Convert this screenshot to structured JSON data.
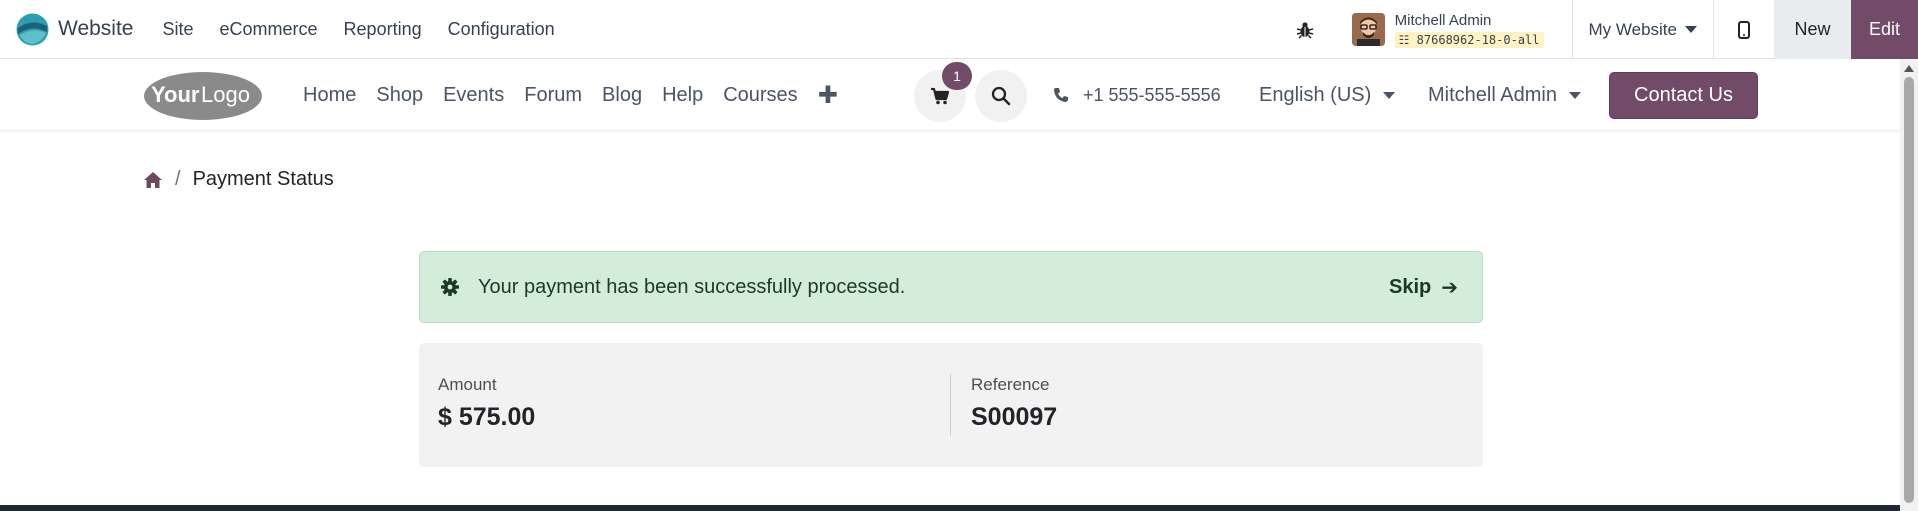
{
  "backend": {
    "app_name": "Website",
    "menu": [
      "Site",
      "eCommerce",
      "Reporting",
      "Configuration"
    ],
    "user_name": "Mitchell Admin",
    "db_name": "87668962-18-0-all",
    "website_selector": "My Website",
    "new_label": "New",
    "edit_label": "Edit",
    "brand_color": "#714b67"
  },
  "site": {
    "nav": [
      "Home",
      "Shop",
      "Events",
      "Forum",
      "Blog",
      "Help",
      "Courses"
    ],
    "cart_count": "1",
    "phone": "+1 555-555-5556",
    "language": "English (US)",
    "account": "Mitchell Admin",
    "contact_label": "Contact Us"
  },
  "breadcrumb": {
    "separator": "/",
    "current": "Payment Status"
  },
  "alert": {
    "message": "Your payment has been successfully processed.",
    "skip_label": "Skip",
    "skip_arrow": "➔"
  },
  "payment": {
    "amount_label": "Amount",
    "amount_value": "$ 575.00",
    "reference_label": "Reference",
    "reference_value": "S00097"
  }
}
